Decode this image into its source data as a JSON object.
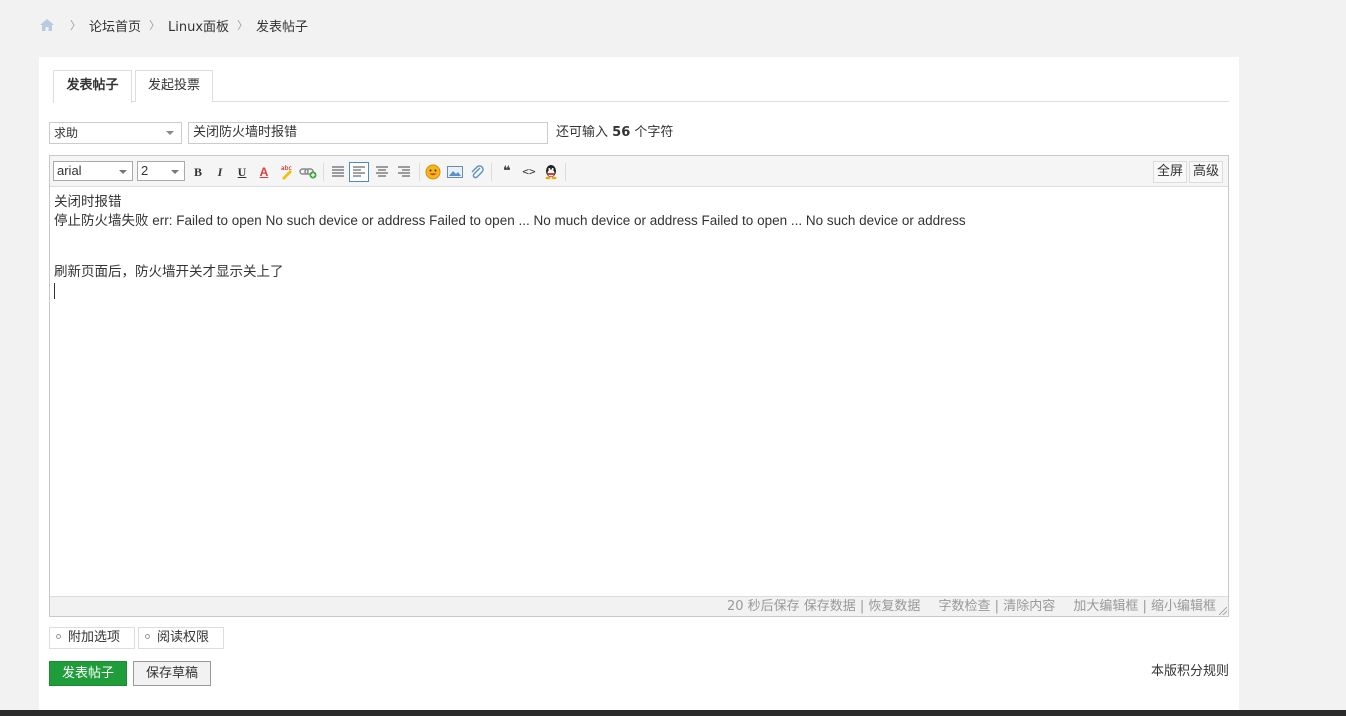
{
  "breadcrumb": {
    "home_icon": "home-icon",
    "items": [
      "论坛首页",
      "Linux面板",
      "发表帖子"
    ]
  },
  "tabs": [
    "发表帖子",
    "发起投票"
  ],
  "form": {
    "type_value": "求助",
    "subject_value": "关闭防火墙时报错",
    "remain_prefix": "还可输入",
    "remain_count": "56",
    "remain_suffix": "个字符"
  },
  "toolbar": {
    "font_family": "arial",
    "font_size": "2",
    "bold": "B",
    "italic": "I",
    "underline": "U",
    "font_color": "A",
    "quote": "❝",
    "code": "<>",
    "fullscreen_label": "全屏",
    "advanced_label": "高级"
  },
  "content": {
    "lines": [
      "关闭时报错",
      "停止防火墙失败 err: Failed to open No such device or address Failed to open ... No much device or address Failed to open ... No such device or address",
      "",
      "刷新页面后，防火墙开关才显示关上了"
    ]
  },
  "statusbar": {
    "autosave": "20 秒后保存 保存数据 | 恢复数据",
    "check": "字数检查 | 清除内容",
    "resize": "加大编辑框 | 缩小编辑框"
  },
  "options": [
    "附加选项",
    "阅读权限"
  ],
  "buttons": {
    "submit": "发表帖子",
    "draft": "保存草稿",
    "rules": "本版积分规则"
  },
  "colors": {
    "submit_green": "#1f9d3b",
    "font_color_red": "#e4393c"
  }
}
